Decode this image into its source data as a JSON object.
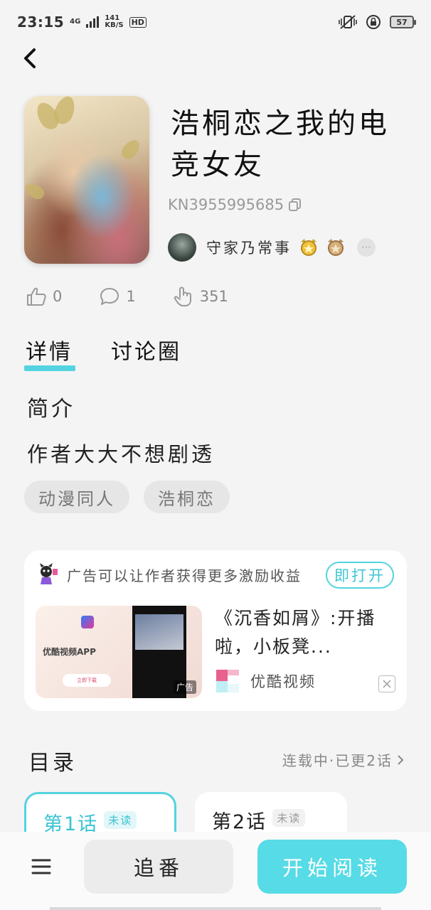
{
  "status_bar": {
    "time": "23:15",
    "network": "4G",
    "speed_value": "141",
    "speed_unit": "KB/S",
    "hd": "HD",
    "battery": "57"
  },
  "book": {
    "title": "浩桐恋之我的电竞女友",
    "id_code": "KN3955995685",
    "author": "守家乃常事",
    "likes": "0",
    "comments": "1",
    "clicks": "351",
    "description_heading": "简介",
    "description": "作者大大不想剧透",
    "tags": [
      "动漫同人",
      "浩桐恋"
    ]
  },
  "tabs": [
    {
      "label": "详情",
      "active": true
    },
    {
      "label": "讨论圈",
      "active": false
    }
  ],
  "ad": {
    "header_text": "广告可以让作者获得更多激励收益",
    "open_label": "即打开",
    "image_app_text": "优酷视频APP",
    "image_button": "立即下载",
    "image_mark": "广告",
    "title": "《沉香如屑》:开播啦，小板凳...",
    "source": "优酷视频"
  },
  "toc": {
    "title": "目录",
    "status": "连载中·已更2话",
    "chapters": [
      {
        "name": "第1话",
        "badge": "未读",
        "active": true
      },
      {
        "name": "第2话",
        "badge": "未读",
        "active": false
      }
    ]
  },
  "bottom": {
    "follow_label": "追番",
    "read_label": "开始阅读"
  },
  "colors": {
    "accent": "#53d3e0",
    "background": "#f4f4f4"
  }
}
